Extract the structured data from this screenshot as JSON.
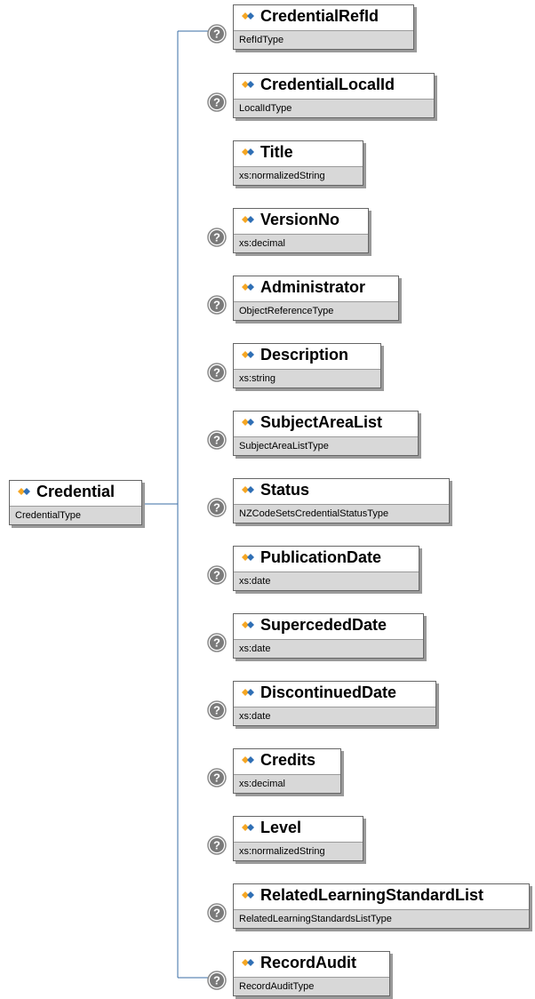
{
  "root": {
    "name": "Credential",
    "type": "CredentialType"
  },
  "children": [
    {
      "name": "CredentialRefId",
      "type": "RefIdType",
      "optional": true
    },
    {
      "name": "CredentialLocalId",
      "type": "LocalIdType",
      "optional": true
    },
    {
      "name": "Title",
      "type": "xs:normalizedString",
      "optional": false
    },
    {
      "name": "VersionNo",
      "type": "xs:decimal",
      "optional": true
    },
    {
      "name": "Administrator",
      "type": "ObjectReferenceType",
      "optional": true
    },
    {
      "name": "Description",
      "type": "xs:string",
      "optional": true
    },
    {
      "name": "SubjectAreaList",
      "type": "SubjectAreaListType",
      "optional": true
    },
    {
      "name": "Status",
      "type": "NZCodeSetsCredentialStatusType",
      "optional": true
    },
    {
      "name": "PublicationDate",
      "type": "xs:date",
      "optional": true
    },
    {
      "name": "SupercededDate",
      "type": "xs:date",
      "optional": true
    },
    {
      "name": "DiscontinuedDate",
      "type": "xs:date",
      "optional": true
    },
    {
      "name": "Credits",
      "type": "xs:decimal",
      "optional": true
    },
    {
      "name": "Level",
      "type": "xs:normalizedString",
      "optional": true
    },
    {
      "name": "RelatedLearningStandardList",
      "type": "RelatedLearningStandardsListType",
      "optional": true
    },
    {
      "name": "RecordAudit",
      "type": "RecordAuditType",
      "optional": true
    }
  ],
  "colors": {
    "connector": "#3a6ea5",
    "optional_badge": "#6e6e6e",
    "type_band": "#d8d8d8"
  },
  "icons": {
    "element": "element-diamond-icon",
    "optional": "question-mark-icon"
  }
}
